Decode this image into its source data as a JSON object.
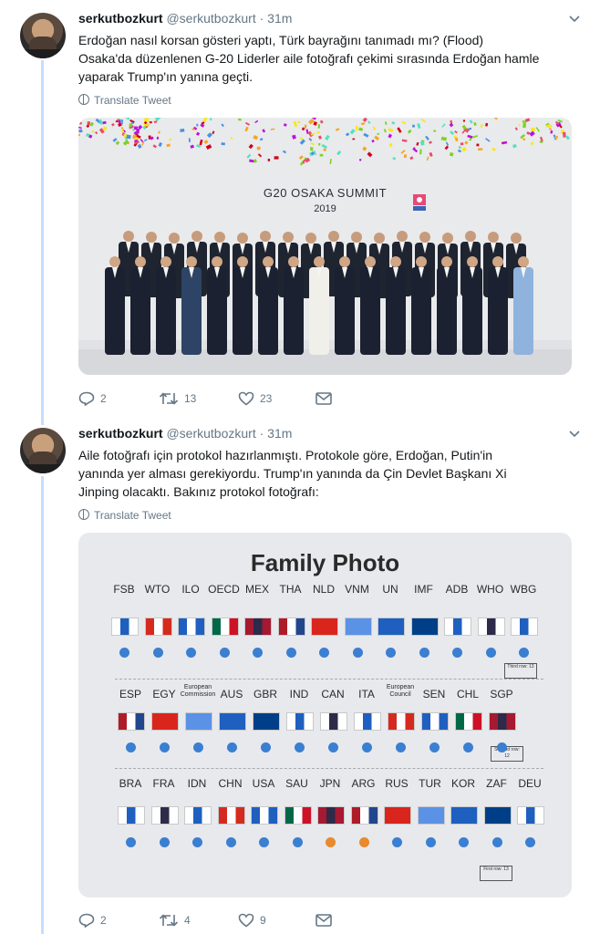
{
  "thread_color": "#c4dfff",
  "tweets": [
    {
      "name": "serkutbozkurt",
      "handle": "@serkutbozkurt",
      "dot": "·",
      "time": "31m",
      "text_lines": [
        "Erdoğan nasıl korsan gösteri yaptı, Türk bayrağını tanımadı mı? (Flood)",
        "Osaka'da düzenlenen G-20 Liderler aile fotoğrafı çekimi sırasında Erdoğan hamle",
        "yaparak Trump'ın yanına geçti."
      ],
      "translate": "Translate Tweet",
      "media": {
        "title": "G20 OSAKA SUMMIT",
        "year": "2019"
      },
      "replies": "2",
      "retweets": "13",
      "likes": "23"
    },
    {
      "name": "serkutbozkurt",
      "handle": "@serkutbozkurt",
      "dot": "·",
      "time": "31m",
      "text_lines": [
        "Aile fotoğrafı için protokol hazırlanmıştı. Protokole göre, Erdoğan, Putin'in",
        "yanında yer alması gerekiyordu. Trump'ın yanında da Çin Devlet Başkanı Xi",
        "Jinping olacaktı. Bakınız protokol fotoğrafı:"
      ],
      "translate": "Translate Tweet",
      "media": {
        "title": "Family Photo",
        "row1": [
          "FSB",
          "WTO",
          "ILO",
          "OECD",
          "MEX",
          "THA",
          "NLD",
          "VNM",
          "UN",
          "IMF",
          "ADB",
          "WHO",
          "WBG"
        ],
        "row2": [
          "ESP",
          "EGY",
          "European Commission",
          "AUS",
          "GBR",
          "IND",
          "CAN",
          "ITA",
          "European Council",
          "SEN",
          "CHL",
          "SGP"
        ],
        "row3": [
          "BRA",
          "FRA",
          "IDN",
          "CHN",
          "USA",
          "SAU",
          "JPN",
          "ARG",
          "RUS",
          "TUR",
          "KOR",
          "ZAF",
          "DEU"
        ],
        "row1_box": "Third row: 13",
        "row2_box": "Second row: 12",
        "row3_box": "First row: 13"
      },
      "replies": "2",
      "retweets": "4",
      "likes": "9"
    }
  ]
}
